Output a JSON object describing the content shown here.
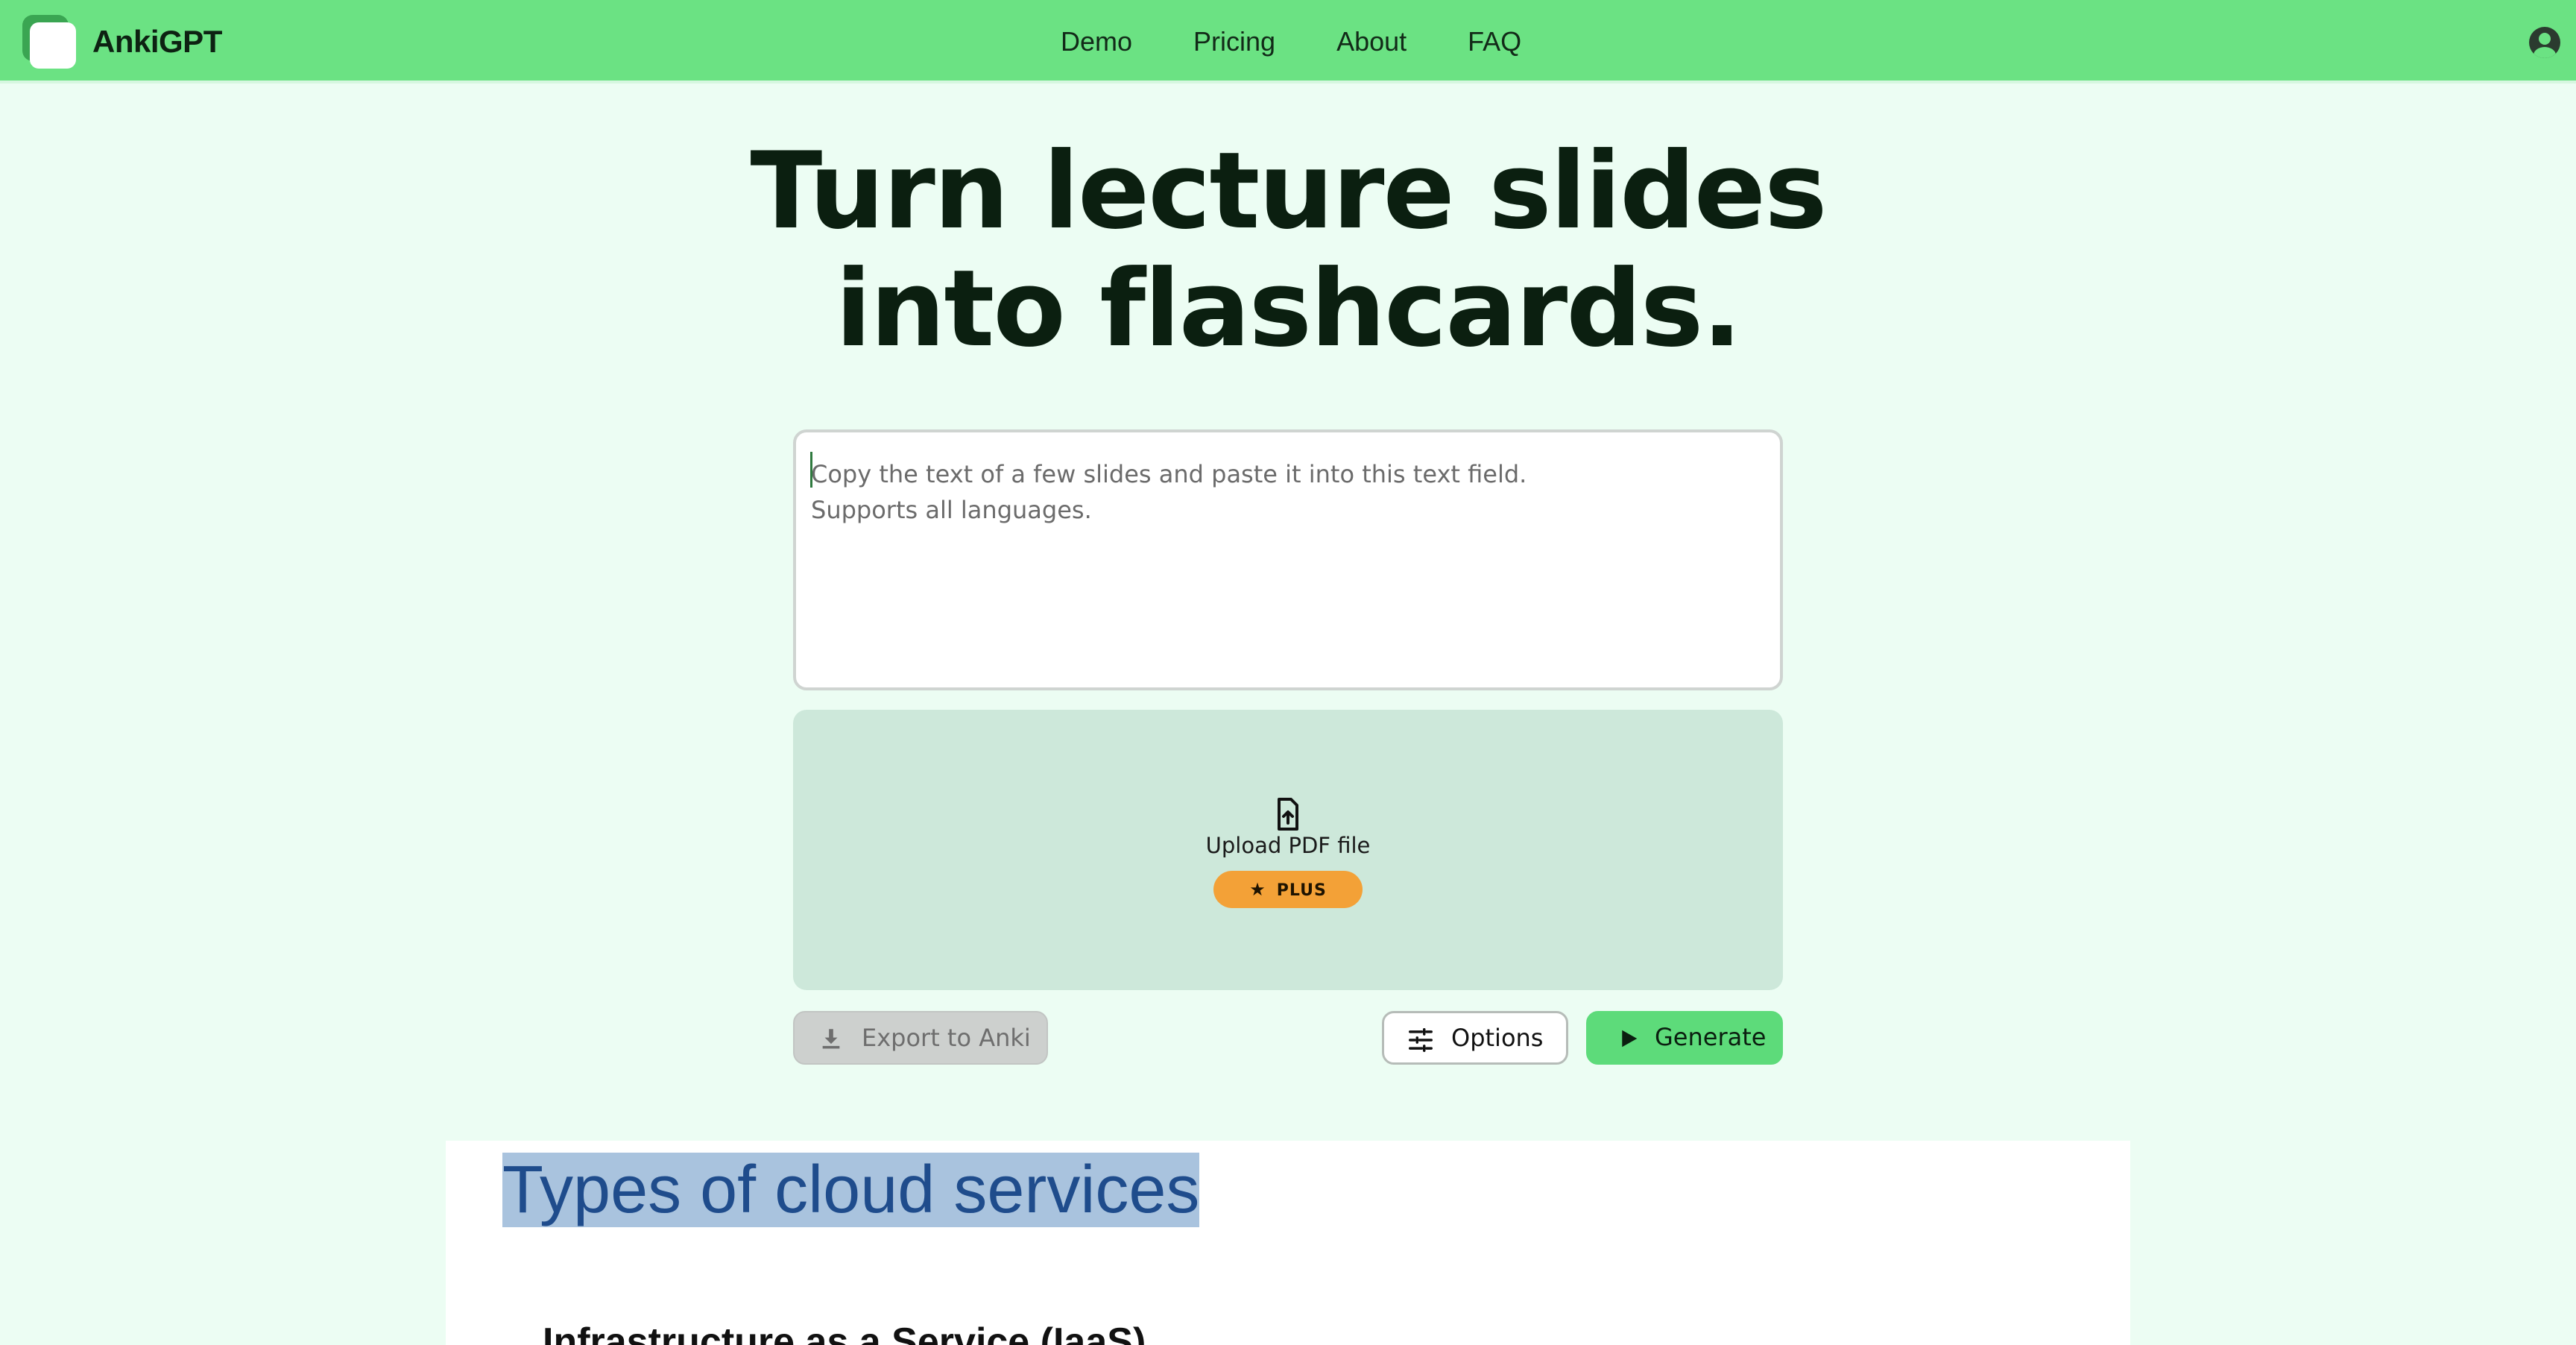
{
  "brand": {
    "name": "AnkiGPT"
  },
  "nav": {
    "items": [
      {
        "label": "Demo"
      },
      {
        "label": "Pricing"
      },
      {
        "label": "About"
      },
      {
        "label": "FAQ"
      }
    ],
    "account_icon": "user-circle-icon"
  },
  "hero": {
    "line1": "Turn lecture slides",
    "line2": "into flashcards."
  },
  "input": {
    "placeholder": "Copy the text of a few slides and paste it into this text field.\nSupports all languages.",
    "value": ""
  },
  "upload": {
    "label": "Upload PDF file",
    "icon": "file-upload-icon",
    "badge": {
      "icon": "star-icon",
      "label": "PLUS",
      "color": "#f3a137"
    }
  },
  "actions": {
    "export_label": "Export to Anki",
    "options_label": "Options",
    "generate_label": "Generate"
  },
  "preview": {
    "title": "Types of cloud services",
    "subtitle": "Infrastructure as a Service (IaaS)"
  },
  "colors": {
    "nav_bg": "#6be283",
    "page_bg": "#ecfdf3",
    "upload_bg": "#cde8da",
    "generate_bg": "#5ddb7a"
  }
}
